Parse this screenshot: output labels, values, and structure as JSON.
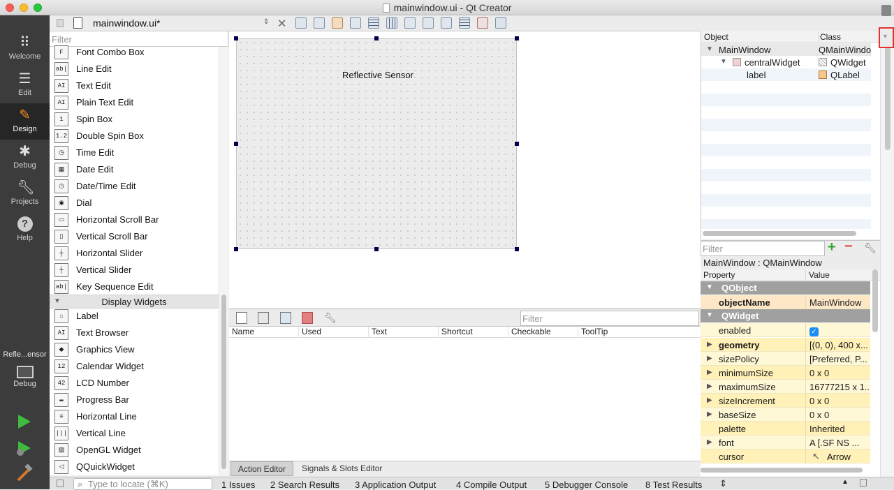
{
  "window": {
    "title": "mainwindow.ui - Qt Creator"
  },
  "modebar": {
    "items": [
      {
        "label": "Welcome",
        "icon": "grid-icon"
      },
      {
        "label": "Edit",
        "icon": "document-icon"
      },
      {
        "label": "Design",
        "icon": "pencil-icon",
        "active": true
      },
      {
        "label": "Debug",
        "icon": "bug-icon"
      },
      {
        "label": "Projects",
        "icon": "wrench-icon"
      },
      {
        "label": "Help",
        "icon": "question-icon"
      }
    ],
    "project_label": "Refle...ensor",
    "kit_label": "Debug"
  },
  "editor_toolbar": {
    "file_name": "mainwindow.ui*"
  },
  "widget_box": {
    "filter_placeholder": "Filter",
    "items_top": [
      {
        "label": "Font Combo Box",
        "icon": "font-combo-icon",
        "glyph": "F"
      },
      {
        "label": "Line Edit",
        "icon": "line-edit-icon",
        "glyph": "ab|"
      },
      {
        "label": "Text Edit",
        "icon": "text-edit-icon",
        "glyph": "AI"
      },
      {
        "label": "Plain Text Edit",
        "icon": "plain-text-edit-icon",
        "glyph": "AI"
      },
      {
        "label": "Spin Box",
        "icon": "spin-box-icon",
        "glyph": "1"
      },
      {
        "label": "Double Spin Box",
        "icon": "double-spin-box-icon",
        "glyph": "1.2"
      },
      {
        "label": "Time Edit",
        "icon": "clock-icon",
        "glyph": "◷"
      },
      {
        "label": "Date Edit",
        "icon": "calendar-icon",
        "glyph": "▦"
      },
      {
        "label": "Date/Time Edit",
        "icon": "datetime-icon",
        "glyph": "◷"
      },
      {
        "label": "Dial",
        "icon": "dial-icon",
        "glyph": "◉"
      },
      {
        "label": "Horizontal Scroll Bar",
        "icon": "hscrollbar-icon",
        "glyph": "▭"
      },
      {
        "label": "Vertical Scroll Bar",
        "icon": "vscrollbar-icon",
        "glyph": "▯"
      },
      {
        "label": "Horizontal Slider",
        "icon": "hslider-icon",
        "glyph": "┼"
      },
      {
        "label": "Vertical Slider",
        "icon": "vslider-icon",
        "glyph": "┼"
      },
      {
        "label": "Key Sequence Edit",
        "icon": "key-sequence-icon",
        "glyph": "ab|"
      }
    ],
    "category": "Display Widgets",
    "items_display": [
      {
        "label": "Label",
        "icon": "label-tag-icon",
        "glyph": "⌂"
      },
      {
        "label": "Text Browser",
        "icon": "text-browser-icon",
        "glyph": "AI"
      },
      {
        "label": "Graphics View",
        "icon": "graphics-view-icon",
        "glyph": "◆"
      },
      {
        "label": "Calendar Widget",
        "icon": "calendar-widget-icon",
        "glyph": "12"
      },
      {
        "label": "LCD Number",
        "icon": "lcd-icon",
        "glyph": "42"
      },
      {
        "label": "Progress Bar",
        "icon": "progress-bar-icon",
        "glyph": "▬"
      },
      {
        "label": "Horizontal Line",
        "icon": "hline-icon",
        "glyph": "≡"
      },
      {
        "label": "Vertical Line",
        "icon": "vline-icon",
        "glyph": "|||"
      },
      {
        "label": "OpenGL Widget",
        "icon": "opengl-icon",
        "glyph": "▨"
      },
      {
        "label": "QQuickWidget",
        "icon": "quick-widget-icon",
        "glyph": "◁"
      }
    ]
  },
  "form": {
    "label_text": "Reflective Sensor"
  },
  "action_editor": {
    "filter_placeholder": "Filter",
    "columns": [
      "Name",
      "Used",
      "Text",
      "Shortcut",
      "Checkable",
      "ToolTip"
    ]
  },
  "editor_tabs": [
    "Action Editor",
    "Signals & Slots Editor"
  ],
  "object_inspector": {
    "headers": [
      "Object",
      "Class"
    ],
    "rows": [
      {
        "object": "MainWindow",
        "class": "QMainWindo"
      },
      {
        "object": "centralWidget",
        "class": "QWidget"
      },
      {
        "object": "label",
        "class": "QLabel"
      }
    ]
  },
  "property_editor": {
    "filter_placeholder": "Filter",
    "title": "MainWindow : QMainWindow",
    "headers": [
      "Property",
      "Value"
    ],
    "sections": [
      "QObject",
      "QWidget"
    ],
    "object_name": {
      "name": "objectName",
      "value": "MainWindow"
    },
    "rows": [
      {
        "name": "enabled",
        "value": ""
      },
      {
        "name": "geometry",
        "value": "[(0, 0), 400 x..."
      },
      {
        "name": "sizePolicy",
        "value": "[Preferred, P..."
      },
      {
        "name": "minimumSize",
        "value": "0 x 0"
      },
      {
        "name": "maximumSize",
        "value": "16777215 x 1..."
      },
      {
        "name": "sizeIncrement",
        "value": "0 x 0"
      },
      {
        "name": "baseSize",
        "value": "0 x 0"
      },
      {
        "name": "palette",
        "value": "Inherited"
      },
      {
        "name": "font",
        "value": "A  [.SF NS ..."
      },
      {
        "name": "cursor",
        "value": "Arrow"
      }
    ]
  },
  "statusbar": {
    "locator_placeholder": "Type to locate (⌘K)",
    "panes": [
      "1  Issues",
      "2  Search Results",
      "3  Application Output",
      "4  Compile Output",
      "5  Debugger Console",
      "8  Test Results"
    ]
  }
}
